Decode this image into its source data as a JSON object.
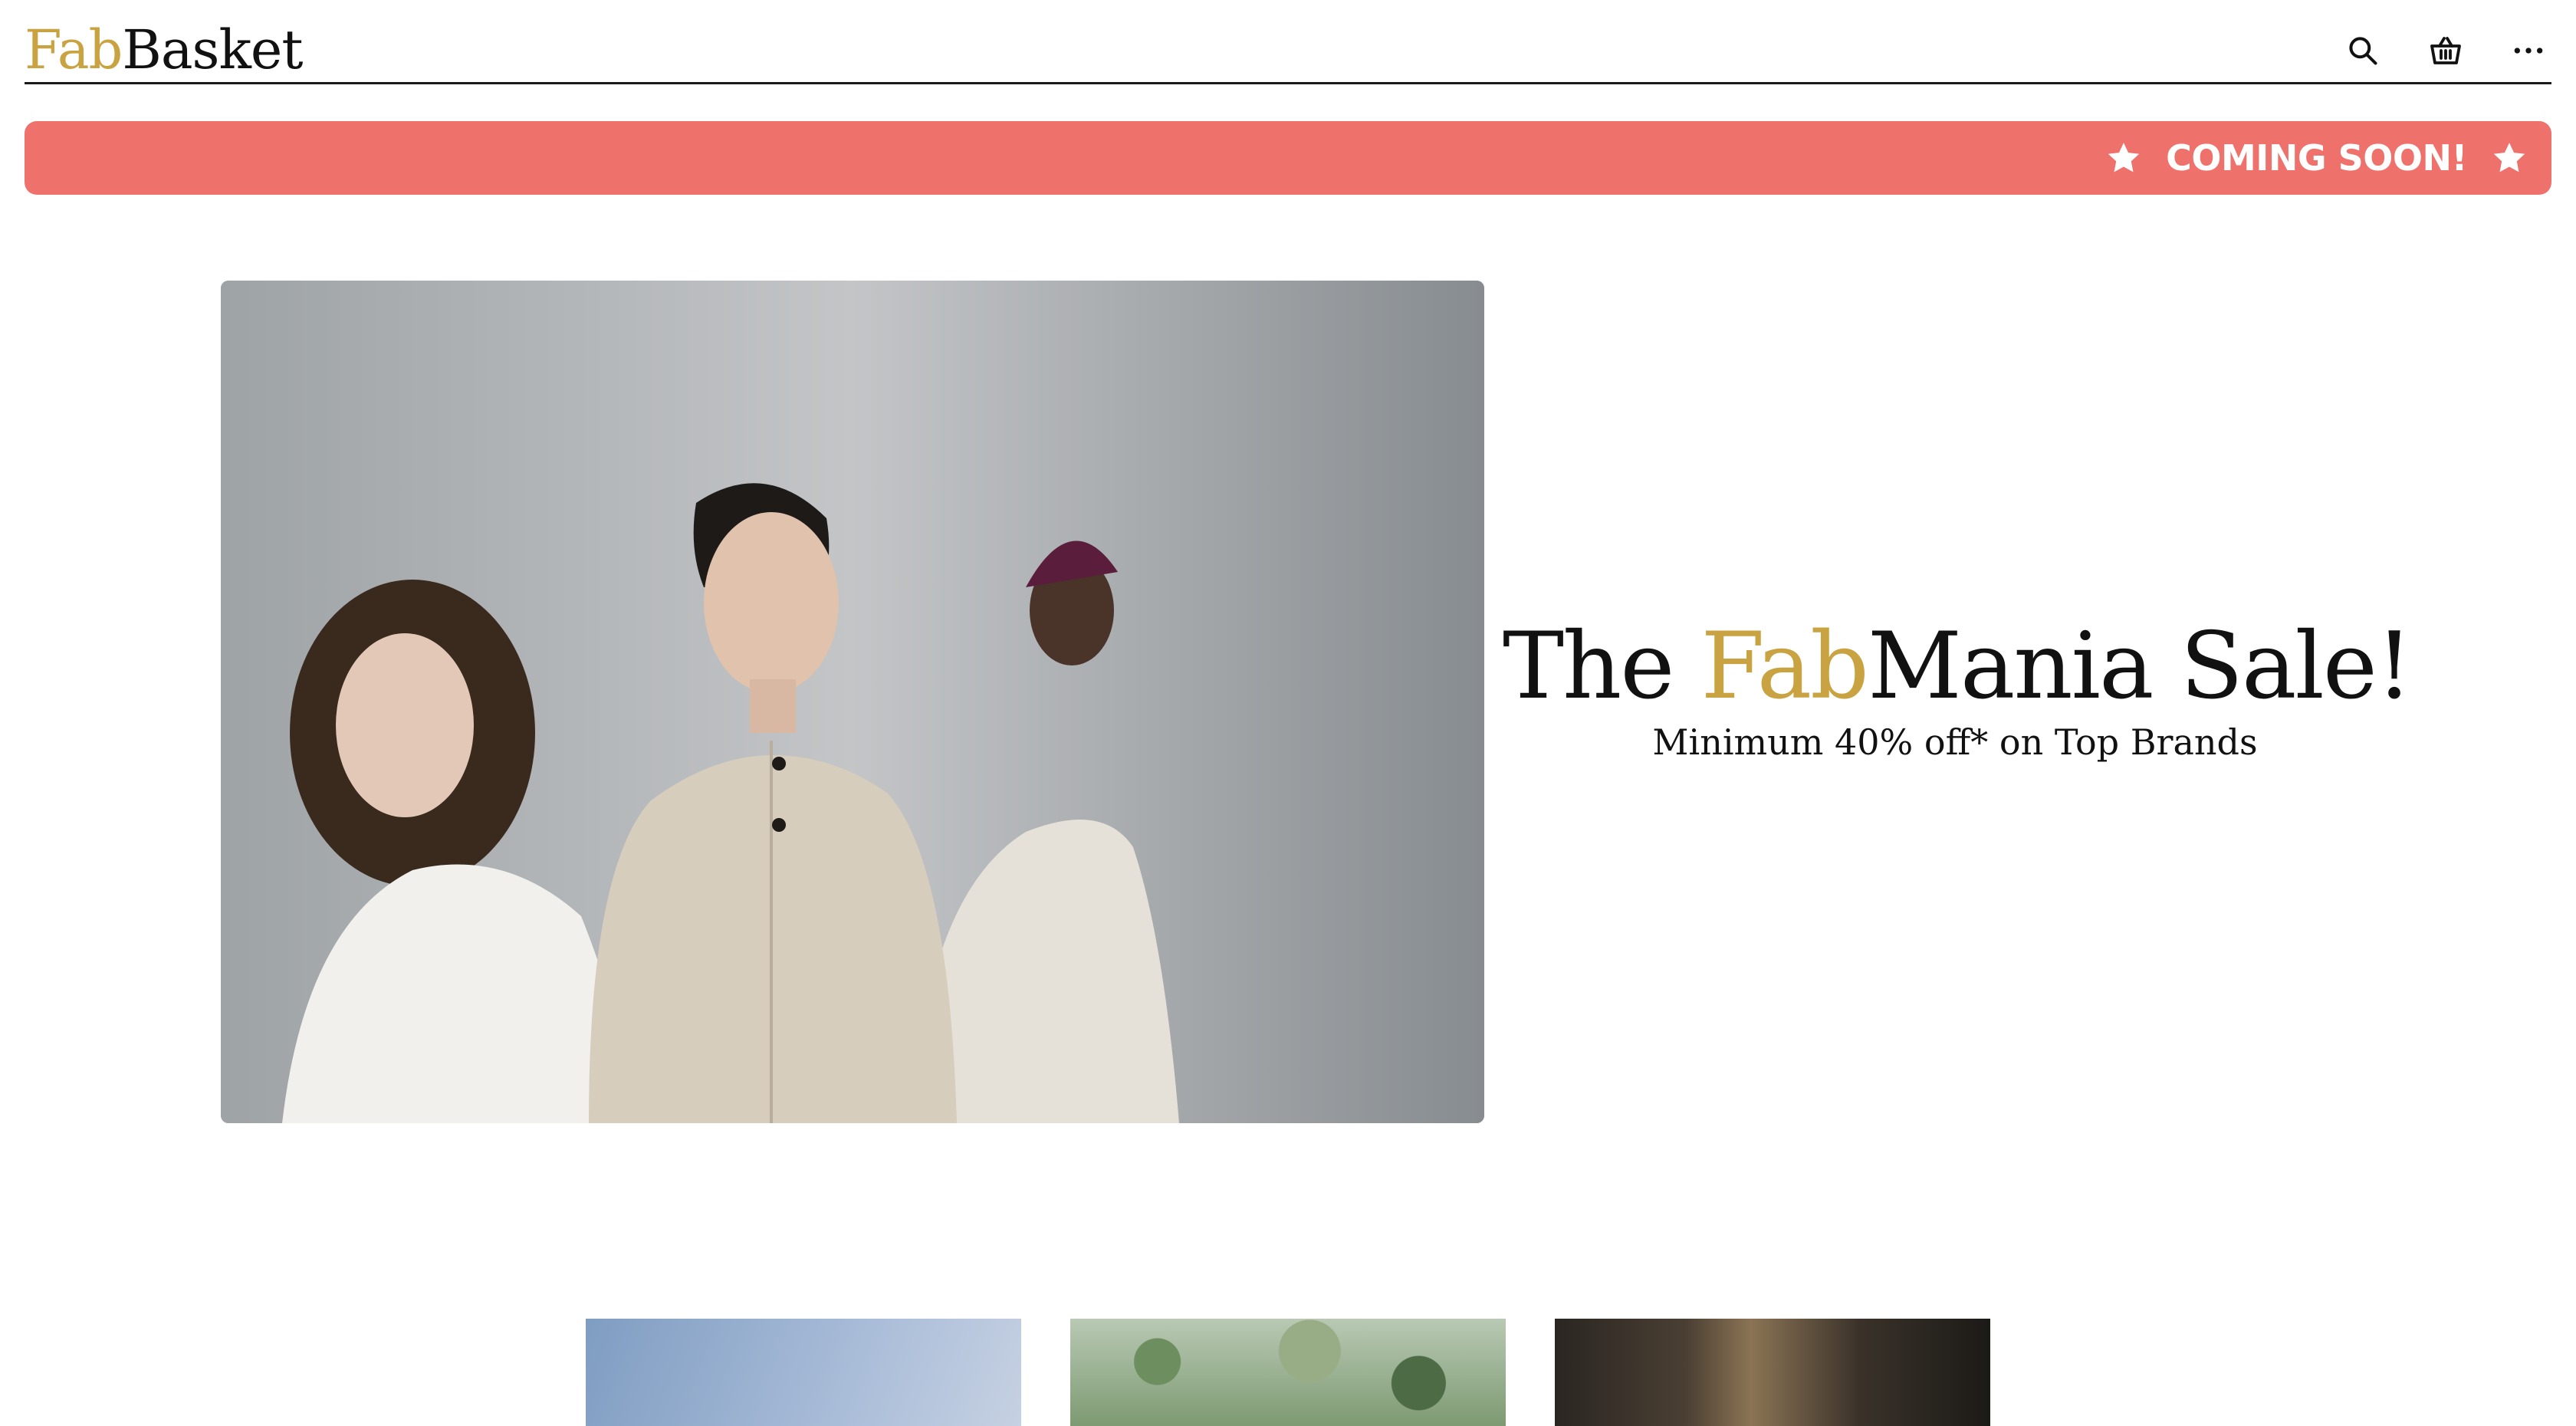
{
  "header": {
    "logo_prefix": "Fab",
    "logo_suffix": "Basket",
    "icons": [
      "search-icon",
      "basket-icon",
      "more-icon"
    ]
  },
  "banner": {
    "text": "COMING SOON!",
    "color": "#ee716c"
  },
  "hero": {
    "title_prefix": "The ",
    "title_highlight": "Fab",
    "title_suffix": "Mania Sale!",
    "subtitle": "Minimum 40% off* on Top Brands"
  },
  "colors": {
    "accent": "#c9a341",
    "text": "#111111",
    "banner": "#ee716c"
  }
}
